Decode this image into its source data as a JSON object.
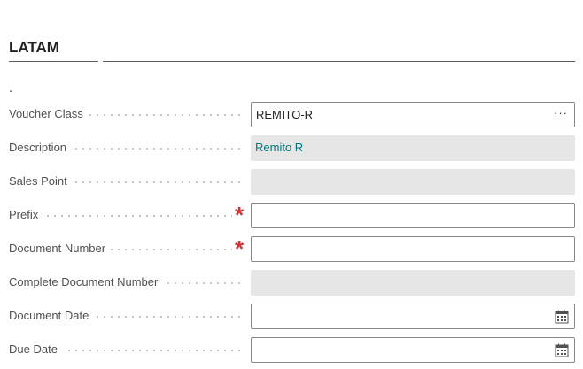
{
  "section": {
    "title": "LATAM",
    "marker": "."
  },
  "fields": {
    "voucher_class": {
      "label": "Voucher Class",
      "value": "REMITO-R",
      "lookup_icon": "ellipsis-icon",
      "lookup_glyph": "···"
    },
    "description": {
      "label": "Description",
      "value": "Remito R"
    },
    "sales_point": {
      "label": "Sales Point",
      "value": ""
    },
    "prefix": {
      "label": "Prefix",
      "value": "",
      "required_mark": "*"
    },
    "document_number": {
      "label": "Document Number",
      "value": "",
      "required_mark": "*"
    },
    "complete_document_number": {
      "label": "Complete Document Number",
      "value": ""
    },
    "document_date": {
      "label": "Document Date",
      "value": "",
      "picker_icon": "calendar-icon"
    },
    "due_date": {
      "label": "Due Date",
      "value": "",
      "picker_icon": "calendar-icon"
    }
  },
  "colors": {
    "required": "#d13438",
    "link_value": "#00787c",
    "readonly_bg": "#e6e6e6",
    "input_border": "#8a8886"
  }
}
